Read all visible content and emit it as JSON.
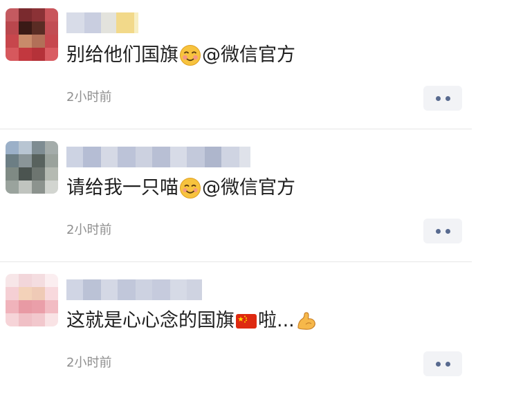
{
  "comments": [
    {
      "text_before": "别给他们国旗",
      "emoji": "flushed-smile-emoji",
      "text_after": "@微信官方",
      "time": "2小时前"
    },
    {
      "text_before": "请给我一只喵",
      "emoji": "smile-emoji",
      "text_after": "@微信官方",
      "time": "2小时前"
    },
    {
      "text_before": "这就是心心念的国旗",
      "emoji": "china-flag-emoji",
      "text_after": "啦...",
      "emoji2": "flexed-arm-emoji",
      "time": "2小时前"
    }
  ],
  "colors": {
    "text": "#1f1f1f",
    "time": "#8f8f8f",
    "button_bg": "#f2f3f6",
    "button_dots": "#586a8f"
  }
}
